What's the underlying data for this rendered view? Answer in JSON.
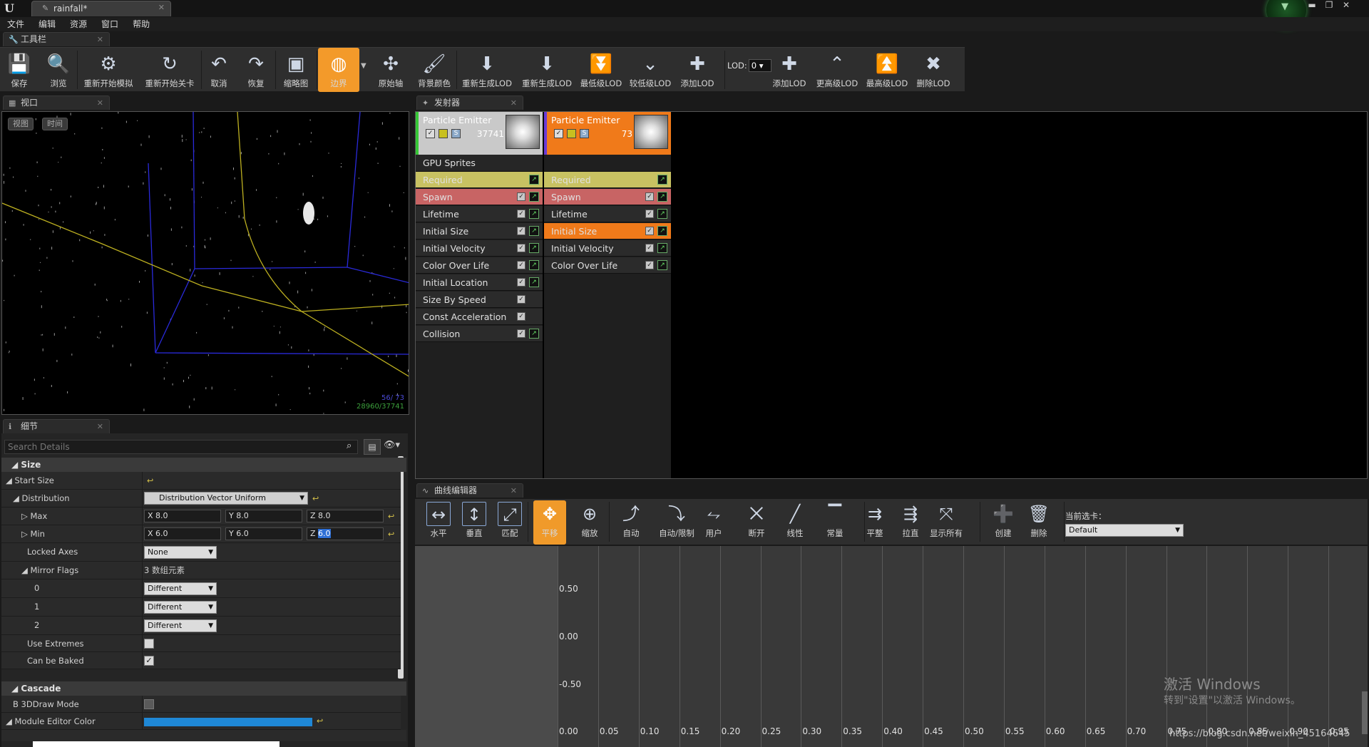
{
  "window": {
    "tab_title": "rainfall*"
  },
  "menu": [
    "文件",
    "编辑",
    "资源",
    "窗口",
    "帮助"
  ],
  "toolbar_tab": "工具栏",
  "toolbar": [
    {
      "label": "保存",
      "icon": "save-icon"
    },
    {
      "label": "浏览",
      "icon": "browse-icon"
    },
    {
      "label": "重新开始模拟",
      "icon": "restart-sim-icon"
    },
    {
      "label": "重新开始关卡",
      "icon": "restart-level-icon"
    },
    {
      "label": "取消",
      "icon": "undo-icon"
    },
    {
      "label": "恢复",
      "icon": "redo-icon"
    },
    {
      "label": "缩略图",
      "icon": "thumbnail-icon"
    },
    {
      "label": "边界",
      "icon": "bounds-icon"
    },
    {
      "label": "原始轴",
      "icon": "origin-axis-icon"
    },
    {
      "label": "背景颜色",
      "icon": "background-color-icon"
    },
    {
      "label": "重新生成LOD",
      "icon": "regen-lod-icon"
    },
    {
      "label": "重新生成LOD",
      "icon": "regen-lod-2-icon"
    },
    {
      "label": "最低级LOD",
      "icon": "lowest-lod-icon"
    },
    {
      "label": "较低级LOD",
      "icon": "lower-lod-icon"
    },
    {
      "label": "添加LOD",
      "icon": "add-lod-icon"
    },
    {
      "label": "添加LOD",
      "icon": "add-lod-2-icon"
    },
    {
      "label": "更高级LOD",
      "icon": "higher-lod-icon"
    },
    {
      "label": "最高级LOD",
      "icon": "highest-lod-icon"
    },
    {
      "label": "删除LOD",
      "icon": "delete-lod-icon"
    }
  ],
  "lod": {
    "label": "LOD:",
    "value": "0"
  },
  "viewport": {
    "tab": "视口",
    "view_btn": "视图",
    "time_btn": "时间",
    "stat1": "56/ 73",
    "stat2": "28960/37741"
  },
  "details": {
    "tab": "细节",
    "search_placeholder": "Search Details",
    "section_size": "Size",
    "start_size": "Start Size",
    "distribution": "Distribution",
    "distribution_value": "Distribution Vector Uniform",
    "max": "Max",
    "min": "Min",
    "max_vals": {
      "x": "8.0",
      "y": "8.0",
      "z": "8.0"
    },
    "min_vals": {
      "x": "6.0",
      "y": "6.0",
      "z": "6.0"
    },
    "locked_axes": "Locked Axes",
    "locked_axes_value": "None",
    "mirror_flags": "Mirror Flags",
    "mirror_flags_value": "3 数组元素",
    "mirror_items": [
      {
        "idx": "0",
        "value": "Different"
      },
      {
        "idx": "1",
        "value": "Different"
      },
      {
        "idx": "2",
        "value": "Different"
      }
    ],
    "use_extremes": "Use Extremes",
    "can_be_baked": "Can be Baked",
    "section_cascade": "Cascade",
    "b3d": "B 3DDraw Mode",
    "module_color": "Module Editor Color",
    "module_color_hex": "#1f88d6"
  },
  "emitters": {
    "tab": "发射器",
    "cols": [
      {
        "name": "Particle Emitter",
        "count": "37741",
        "type": "GPU Sprites",
        "modules": [
          "Required",
          "Spawn",
          "Lifetime",
          "Initial Size",
          "Initial Velocity",
          "Color Over Life",
          "Initial Location",
          "Size By Speed",
          "Const Acceleration",
          "Collision"
        ]
      },
      {
        "name": "Particle Emitter",
        "count": "73",
        "type": "",
        "modules": [
          "Required",
          "Spawn",
          "Lifetime",
          "Initial Size",
          "Initial Velocity",
          "Color Over Life"
        ]
      }
    ]
  },
  "curve_editor": {
    "tab": "曲线编辑器",
    "tools": [
      "水平",
      "垂直",
      "匹配",
      "平移",
      "缩放",
      "自动",
      "自动/限制",
      "用户",
      "断开",
      "线性",
      "常量",
      "平整",
      "拉直",
      "显示所有",
      "创建",
      "删除"
    ],
    "current_tab_label": "当前选卡：",
    "current_tab_value": "Default",
    "x_ticks": [
      "0.00",
      "0.05",
      "0.10",
      "0.15",
      "0.20",
      "0.25",
      "0.30",
      "0.35",
      "0.40",
      "0.45",
      "0.50",
      "0.55",
      "0.60",
      "0.65",
      "0.70",
      "0.75",
      "0.80",
      "0.85",
      "0.90",
      "0.95"
    ],
    "y_ticks": [
      "0.50",
      "0.00",
      "-0.50"
    ]
  },
  "watermark": {
    "line1": "激活 Windows",
    "line2": "转到\"设置\"以激活 Windows。"
  },
  "url": "https://blog.csdn.net/weixin_45164645"
}
